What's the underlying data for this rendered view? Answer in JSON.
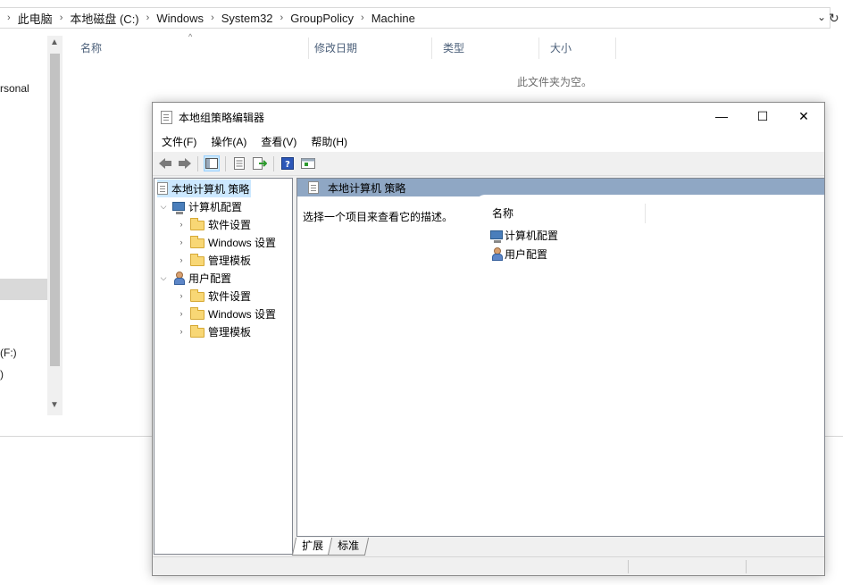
{
  "explorer": {
    "breadcrumb": [
      "此电脑",
      "本地磁盘 (C:)",
      "Windows",
      "System32",
      "GroupPolicy",
      "Machine"
    ],
    "nav_fragments": [
      "rsonal",
      "(F:)",
      ")"
    ],
    "columns": [
      "名称",
      "修改日期",
      "类型",
      "大小"
    ],
    "empty_message": "此文件夹为空。"
  },
  "gpedit": {
    "title": "本地组策略编辑器",
    "window_buttons": {
      "minimize": "—",
      "maximize": "☐",
      "close": "✕"
    },
    "menu": [
      "文件(F)",
      "操作(A)",
      "查看(V)",
      "帮助(H)"
    ],
    "tree": {
      "root": "本地计算机 策略",
      "computer_config": "计算机配置",
      "user_config": "用户配置",
      "software_settings": "软件设置",
      "windows_settings": "Windows 设置",
      "admin_templates": "管理模板"
    },
    "right_pane": {
      "header": "本地计算机 策略",
      "description": "选择一个项目来查看它的描述。",
      "column_name": "名称",
      "items": [
        "计算机配置",
        "用户配置"
      ]
    },
    "tabs": [
      "扩展",
      "标准"
    ]
  }
}
